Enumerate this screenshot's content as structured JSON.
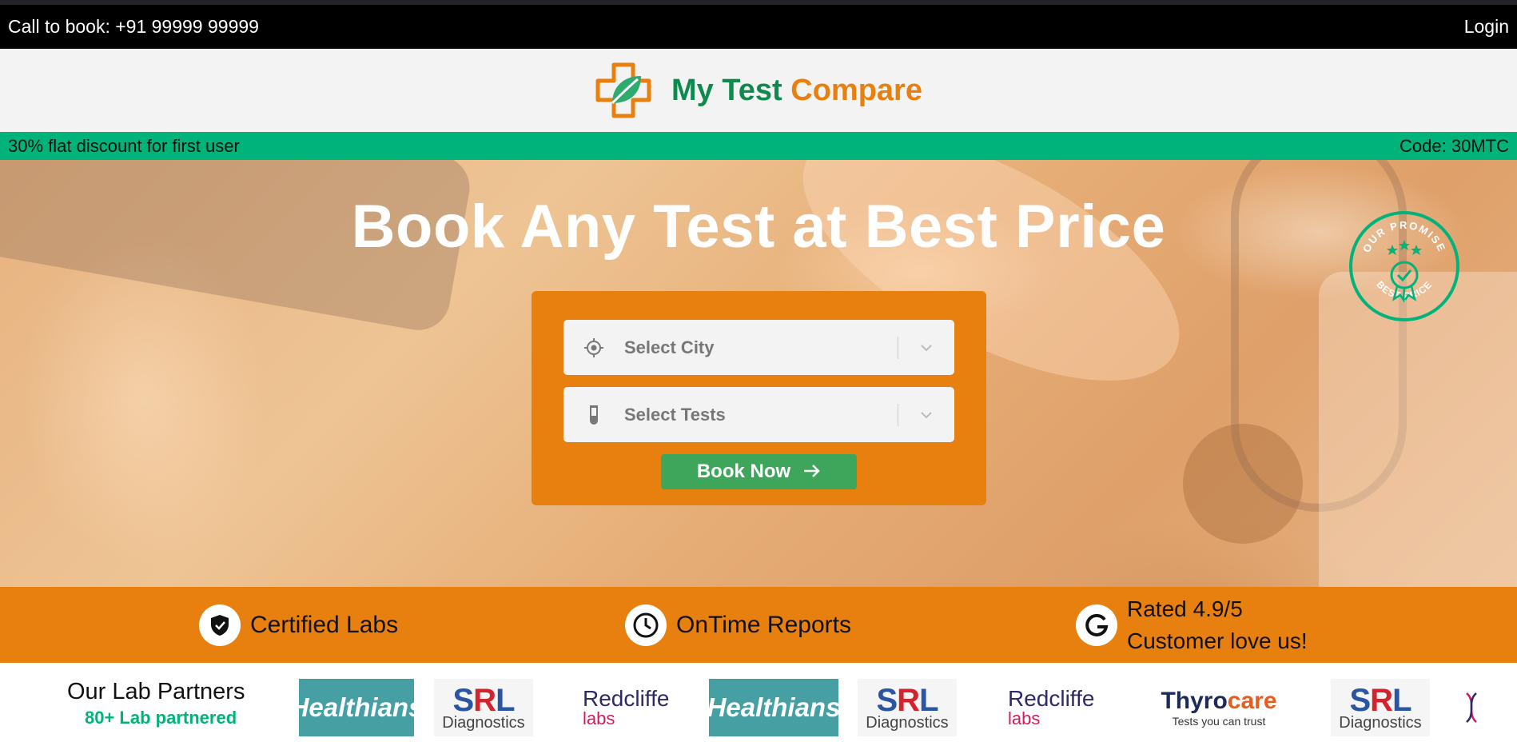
{
  "topbar": {
    "call_text": "Call to book: +91 99999 99999",
    "login_label": "Login"
  },
  "header": {
    "brand_part1": "My Test",
    "brand_part2": "Compare"
  },
  "promo": {
    "left_text": "30% flat discount for first user",
    "right_text": "Code: 30MTC"
  },
  "hero": {
    "title": "Book Any Test at Best Price",
    "badge_top": "OUR PROMISE",
    "badge_bottom": "BEST PRICE",
    "city_placeholder": "Select City",
    "tests_placeholder": "Select Tests",
    "book_now_label": "Book Now"
  },
  "features": [
    {
      "label": "Certified Labs"
    },
    {
      "label": "OnTime Reports"
    },
    {
      "line1": "Rated 4.9/5",
      "line2": "Customer love us!"
    }
  ],
  "partners": {
    "title": "Our Lab Partners",
    "subtitle": "80+ Lab partnered",
    "healthians": "Healthians",
    "srl_mark": "SRL",
    "srl_sub": "Diagnostics",
    "redcliffe_1": "Redcliffe",
    "redcliffe_2": "labs",
    "thyro_1": "Thyro",
    "thyro_2": "care",
    "thyro_tag": "Tests you can trust"
  },
  "colors": {
    "orange": "#e8800f",
    "green": "#00b37a",
    "button_green": "#3ea65a",
    "brand_green": "#0e8a4f"
  }
}
